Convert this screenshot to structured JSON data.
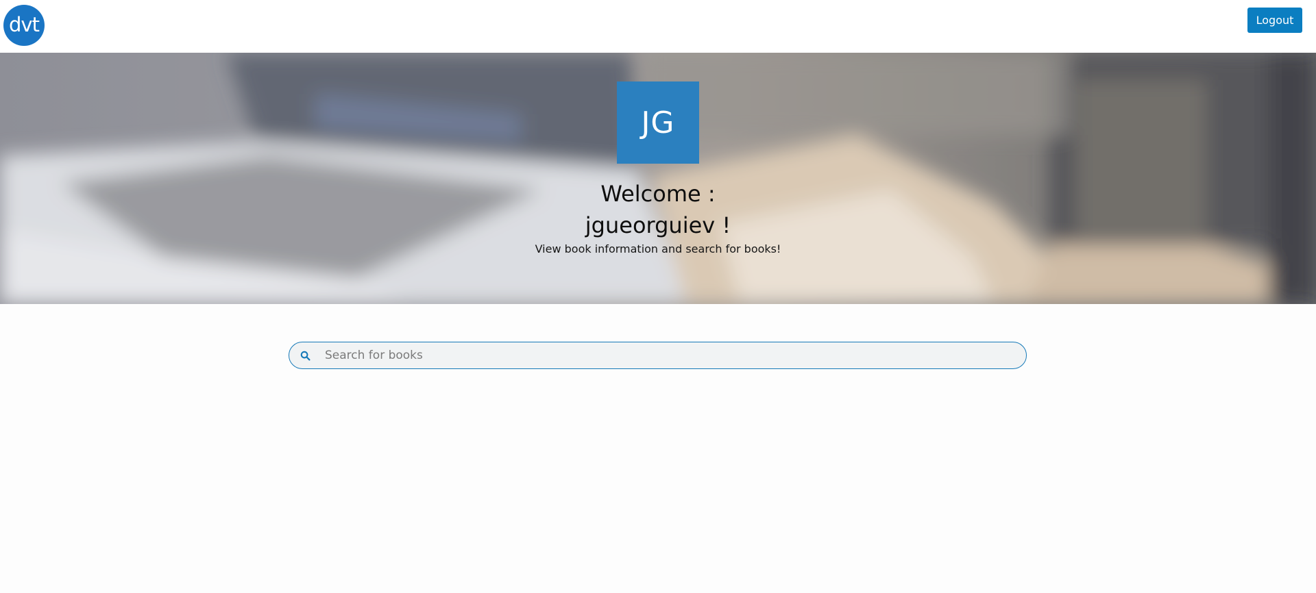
{
  "header": {
    "logo_text": "dvt",
    "logout_label": "Logout",
    "colors": {
      "logo": "#1a75c4",
      "logout": "#0b7ec1"
    }
  },
  "hero": {
    "avatar_initials": "JG",
    "welcome_line1": "Welcome :",
    "welcome_line2": "jgueorguiev !",
    "subtitle": "View book information and search for books!",
    "colors": {
      "avatar": "#2b80bf"
    }
  },
  "search": {
    "placeholder": "Search for books",
    "value": "",
    "icon": "search-icon",
    "colors": {
      "border": "#1579b8",
      "background": "#f1f3f4"
    }
  }
}
